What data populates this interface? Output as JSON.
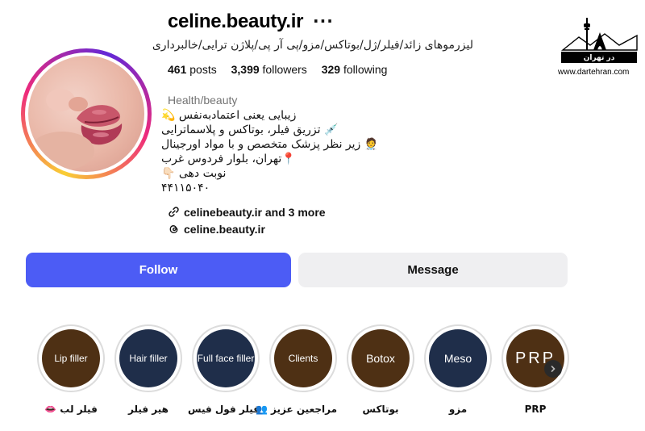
{
  "profile": {
    "username": "celine.beauty.ir",
    "more": "···",
    "subtitle": "لیزرموهای زائد/فیلر/ژل/بوتاکس/مزو/پی آر پی/پلاژن ترایی/خالبرداری",
    "stats": {
      "posts_count": "461",
      "posts_label": "posts",
      "followers_count": "3,399",
      "followers_label": "followers",
      "following_count": "329",
      "following_label": "following"
    },
    "category": "Health/beauty",
    "bio": [
      "زیبایی یعنی اعتمادبه‌نفس 💫",
      "💉 تزریق فیلر، بوتاکس و پلاسماترایی",
      "🧑‍⚕️ زیر نظر پزشک متخصص و با مواد اورجینال",
      "📍تهران، بلوار فردوس غرب",
      "نوبت دهی 👇🏻",
      "۴۴۱۱۵۰۴۰"
    ],
    "link": "celinebeauty.ir and 3 more",
    "threads": "celine.beauty.ir"
  },
  "logo": {
    "text": "در تهران",
    "site": "www.dartehran.com"
  },
  "buttons": {
    "follow": "Follow",
    "message": "Message"
  },
  "highlights": [
    {
      "title": "Lip filler",
      "label": "فیلر لب 👄",
      "color": "#4e3014"
    },
    {
      "title": "Hair filler",
      "label": "هیر فیلر",
      "color": "#1f2e4a"
    },
    {
      "title": "Full face filler",
      "label": "فیلر فول فیس",
      "color": "#1f2e4a"
    },
    {
      "title": "Clients",
      "label": "مراجعین عزیز 👥",
      "color": "#4e3014"
    },
    {
      "title": "Botox",
      "label": "بوتاکس",
      "color": "#4e3014"
    },
    {
      "title": "Meso",
      "label": "مزو",
      "color": "#1f2e4a"
    },
    {
      "title": "PRP",
      "label": "PRP",
      "color": "#4e3014"
    }
  ]
}
